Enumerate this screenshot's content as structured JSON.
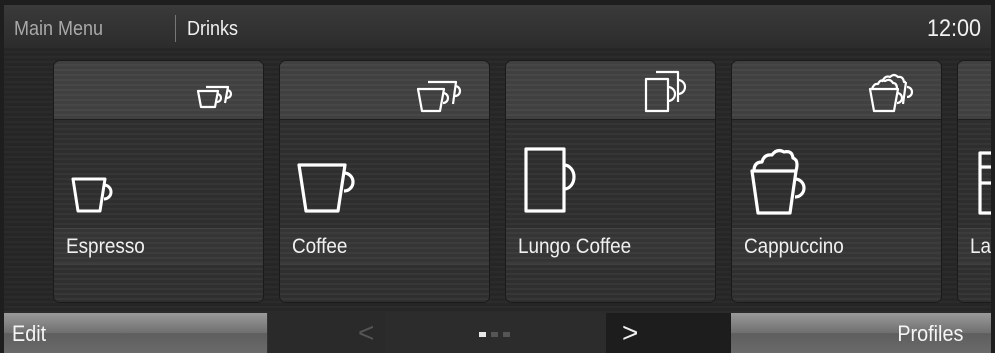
{
  "header": {
    "breadcrumb_root": "Main Menu",
    "breadcrumb_current": "Drinks",
    "clock": "12:00"
  },
  "drinks": [
    {
      "label": "Espresso",
      "icon": "espresso-cup-icon"
    },
    {
      "label": "Coffee",
      "icon": "coffee-cup-icon"
    },
    {
      "label": "Lungo Coffee",
      "icon": "lungo-mug-icon"
    },
    {
      "label": "Cappuccino",
      "icon": "cappuccino-cup-icon"
    },
    {
      "label": "La",
      "icon": "latte-glass-icon"
    }
  ],
  "footer": {
    "edit_label": "Edit",
    "prev_symbol": "<",
    "next_symbol": ">",
    "profiles_label": "Profiles",
    "page_count": 3,
    "current_page": 1
  },
  "colors": {
    "icon_stroke": "#ffffff",
    "active_dot": "#e8e8e8",
    "inactive_dot": "#555555"
  }
}
